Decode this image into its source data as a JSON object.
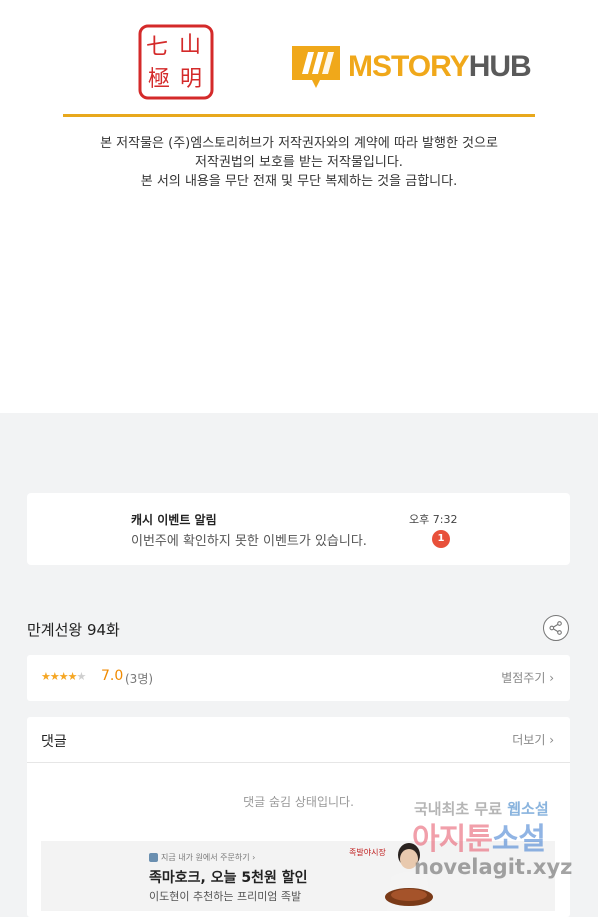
{
  "publisher": {
    "seal_chars": [
      "七",
      "山",
      "極",
      "明"
    ],
    "logo_main": "MSTORY",
    "logo_hub": "HUB",
    "notice_lines": [
      "본 저작물은 (주)엠스토리허브가 저작권자와의 계약에 따라 발행한 것으로",
      "저작권법의 보호를 받는 저작물입니다.",
      "본 서의 내용을 무단 전재 및 무단 복제하는 것을 금합니다."
    ]
  },
  "event": {
    "title": "캐시 이벤트 알림",
    "description": "이번주에 확인하지 못한 이벤트가 있습니다.",
    "time": "오후 7:32",
    "badge_count": "1"
  },
  "episode": {
    "title": "만계선왕 94화",
    "share_icon": "share-icon"
  },
  "rating": {
    "stars_value": 3.5,
    "stars_max": 5,
    "score": "7.0",
    "count": "(3명)",
    "rate_label": "별점주기 ›"
  },
  "comments": {
    "title": "댓글",
    "more_label": "더보기 ›",
    "hidden_message": "댓글 숨김 상태입니다."
  },
  "ad": {
    "top_line": "지금 내가 원에서 주문하기 ›",
    "title": "족마호크, 오늘 5천원 할인",
    "subtitle": "이도현이 추천하는 프리미엄 족발",
    "brand": "족발야시장"
  },
  "watermark": {
    "line1_a": "국내최초 무료 ",
    "line1_b": "웹소설",
    "line2_a": "아지툰",
    "line2_b": "소설",
    "line3": "novelagit.xyz"
  },
  "colors": {
    "accent_gold": "#e8a81c",
    "badge_red": "#e8503a",
    "star_orange": "#f5a623",
    "seal_red": "#d42a2a"
  }
}
